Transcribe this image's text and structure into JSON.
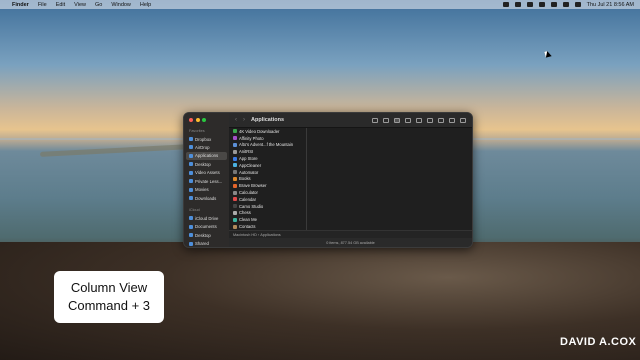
{
  "menubar": {
    "items": [
      "Finder",
      "File",
      "Edit",
      "View",
      "Go",
      "Window",
      "Help"
    ],
    "clock": "Thu Jul 21  8:56 AM"
  },
  "finder": {
    "title": "Applications",
    "sidebar": {
      "favorites_header": "Favorites",
      "favorites": [
        "Dropbox",
        "AirDrop",
        "Applications",
        "Desktop",
        "Video Assets",
        "Private Less...",
        "Movies",
        "Downloads"
      ],
      "icloud_header": "iCloud",
      "icloud": [
        "iCloud Drive",
        "Documents",
        "Desktop",
        "Shared"
      ]
    },
    "apps": [
      "4K Video Downloader",
      "Affinity Photo",
      "Alto's Advent...f the Mountain",
      "AnitRSI",
      "App Store",
      "AppCleaner",
      "Automator",
      "Books",
      "Brave Browser",
      "Calculator",
      "Calendar",
      "Camo Studio",
      "Chess",
      "Clean Me",
      "Contacts"
    ],
    "path": [
      "Macintosh HD",
      "Applications"
    ],
    "status": "0 items, 877.54 GB available"
  },
  "caption": {
    "line1": "Column View",
    "line2": "Command + 3"
  },
  "watermark": "DAVID A.COX"
}
